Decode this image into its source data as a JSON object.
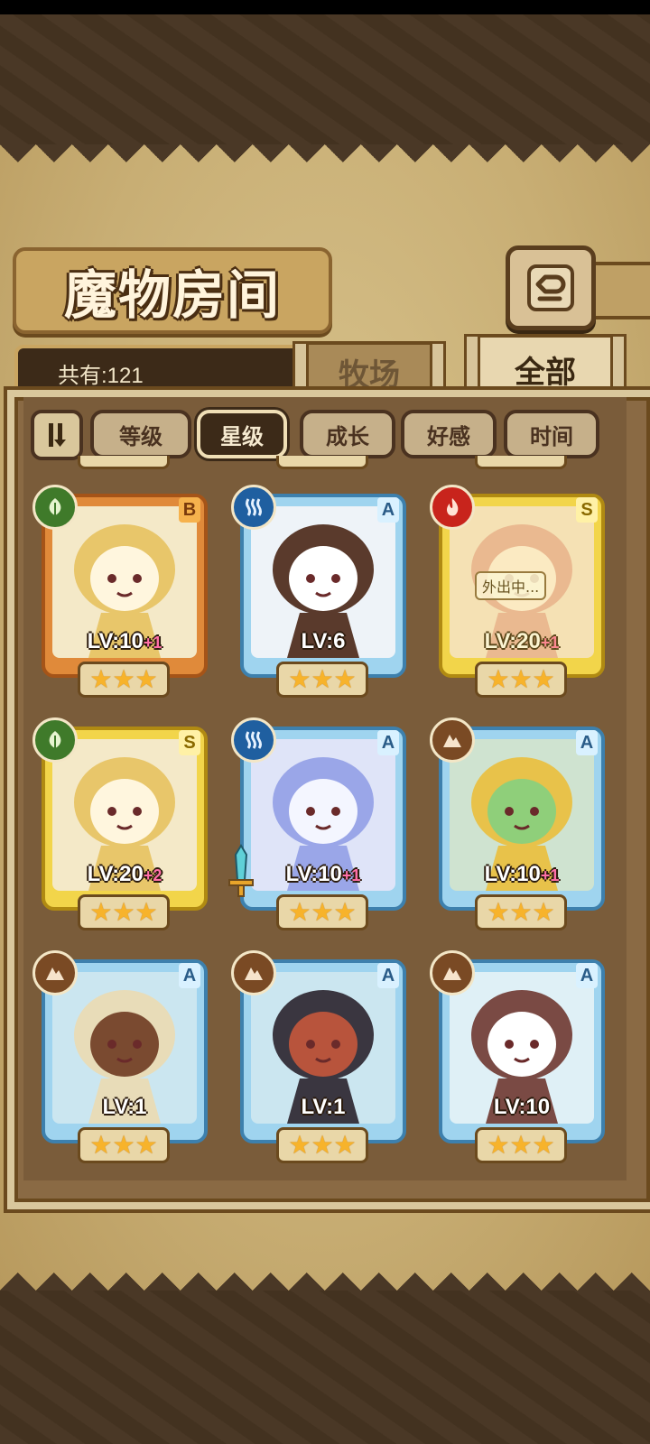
{
  "header": {
    "title": "魔物房间",
    "back_icon": "return-arrow-icon"
  },
  "count": {
    "text": "共有:121"
  },
  "tabs": [
    {
      "label": "牧场",
      "active": false
    },
    {
      "label": "全部",
      "active": true
    }
  ],
  "sort": {
    "toggle_icon": "sort-order-icon",
    "buttons": [
      {
        "label": "等级",
        "active": false
      },
      {
        "label": "星级",
        "active": true
      },
      {
        "label": "成长",
        "active": false
      },
      {
        "label": "好感",
        "active": false
      },
      {
        "label": "时间",
        "active": false
      }
    ]
  },
  "monsters": [
    {
      "element": "nature",
      "rank": "B",
      "frame": "orange",
      "level": "LV:10",
      "plus": "+1",
      "stars": 3,
      "away": "",
      "sprite": "fairy-girl-blonde"
    },
    {
      "element": "water",
      "rank": "A",
      "frame": "blue",
      "level": "LV:6",
      "plus": "",
      "stars": 3,
      "away": "",
      "sprite": "dark-elf-valkyrie"
    },
    {
      "element": "fire",
      "rank": "S",
      "frame": "yellow",
      "level": "LV:20",
      "plus": "+1",
      "stars": 3,
      "away": "外出中...",
      "sprite": "pink-hair-girl"
    },
    {
      "element": "nature",
      "rank": "S",
      "frame": "yellow",
      "level": "LV:20",
      "plus": "+2",
      "stars": 3,
      "away": "",
      "sprite": "fairy-girl-blonde"
    },
    {
      "element": "water",
      "rank": "A",
      "frame": "blue",
      "level": "LV:10",
      "plus": "+1",
      "stars": 3,
      "away": "",
      "sprite": "crystal-winged-girl",
      "equip": "sword-icon"
    },
    {
      "element": "earth",
      "rank": "A",
      "frame": "blue",
      "level": "LV:10",
      "plus": "+1",
      "stars": 3,
      "away": "",
      "sprite": "goblin-girl"
    },
    {
      "element": "earth",
      "rank": "A",
      "frame": "blue",
      "level": "LV:1",
      "plus": "",
      "stars": 3,
      "away": "",
      "sprite": "aviator-goblin"
    },
    {
      "element": "earth",
      "rank": "A",
      "frame": "blue",
      "level": "LV:1",
      "plus": "",
      "stars": 3,
      "away": "",
      "sprite": "horned-goblin"
    },
    {
      "element": "earth",
      "rank": "A",
      "frame": "blue",
      "level": "LV:10",
      "plus": "",
      "stars": 3,
      "away": "",
      "sprite": "chef-girl"
    }
  ],
  "colors": {
    "nature": "#3f7a2a",
    "water": "#1f5fa0",
    "fire": "#c8241c",
    "earth": "#7a4a24"
  }
}
